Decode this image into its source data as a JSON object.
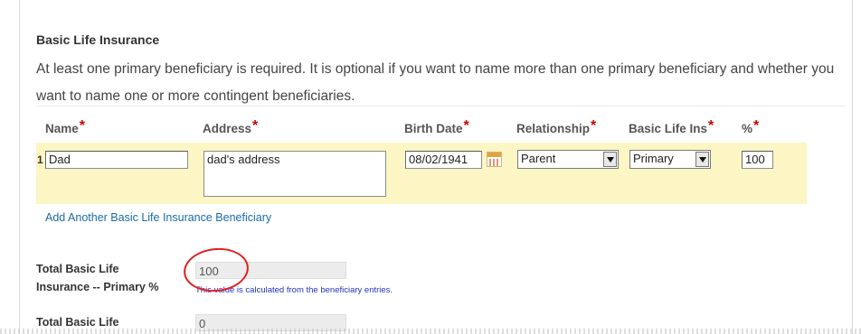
{
  "section": {
    "title": "Basic Life Insurance",
    "description": "At least one primary beneficiary is required. It is optional if you want to name more than one primary beneficiary and whether you want to name one or more contingent beneficiaries."
  },
  "columns": {
    "name": "Name",
    "address": "Address",
    "birth_date": "Birth Date",
    "relationship": "Relationship",
    "basic_life_ins": "Basic Life Ins",
    "percent": "%",
    "required_mark": "*"
  },
  "row": {
    "number": "1",
    "name": "Dad",
    "address": "dad's address",
    "birth_date": "08/02/1941",
    "relationship": "Parent",
    "basic_life_ins": "Primary",
    "percent": "100"
  },
  "add_link": "Add Another Basic Life Insurance Beneficiary",
  "totals": {
    "primary_label_1": "Total Basic Life",
    "primary_label_2": "Insurance -- Primary %",
    "primary_value": "100",
    "calc_note": "This value is calculated from the beneficiary entries.",
    "contingent_label_1": "Total Basic Life",
    "contingent_value": "0"
  },
  "colors": {
    "highlight": "#fcf5c4",
    "required": "#cc0000",
    "annotation_circle": "#e02020",
    "link": "#1a6ba8"
  }
}
